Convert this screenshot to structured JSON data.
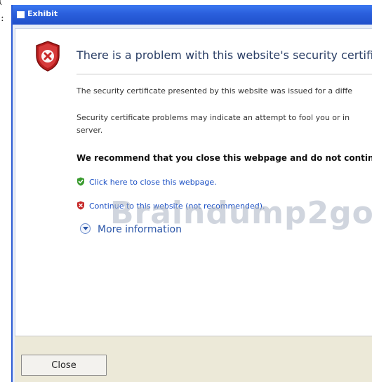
{
  "outer": {
    "left_clip_text": "(",
    "colon": ":"
  },
  "window": {
    "title": "Exhibit"
  },
  "dialog": {
    "heading": "There is a problem with this website's security certificat",
    "para1": "The security certificate presented by this website was issued for a diffe",
    "para2_line1": "Security certificate problems may indicate an attempt to fool you or in",
    "para2_line2": "server.",
    "recommendation": "We recommend that you close this webpage and do not continu",
    "link_close": "Click here to close this webpage.",
    "link_continue": "Continue to this website (not recommended).",
    "more_info": "More information",
    "watermark": "Braindump2go."
  },
  "buttons": {
    "close_label": "Close"
  },
  "colors": {
    "titlebar": "#2a5fdc",
    "link": "#1a4fc4",
    "heading": "#2b3f66",
    "shield_red": "#c62828",
    "check_green": "#3a9b2f"
  },
  "icons": {
    "title": "window-icon",
    "shield": "error-shield-icon",
    "check": "green-check-shield-icon",
    "x": "red-x-shield-icon",
    "expand": "chevron-down-circle-icon"
  }
}
